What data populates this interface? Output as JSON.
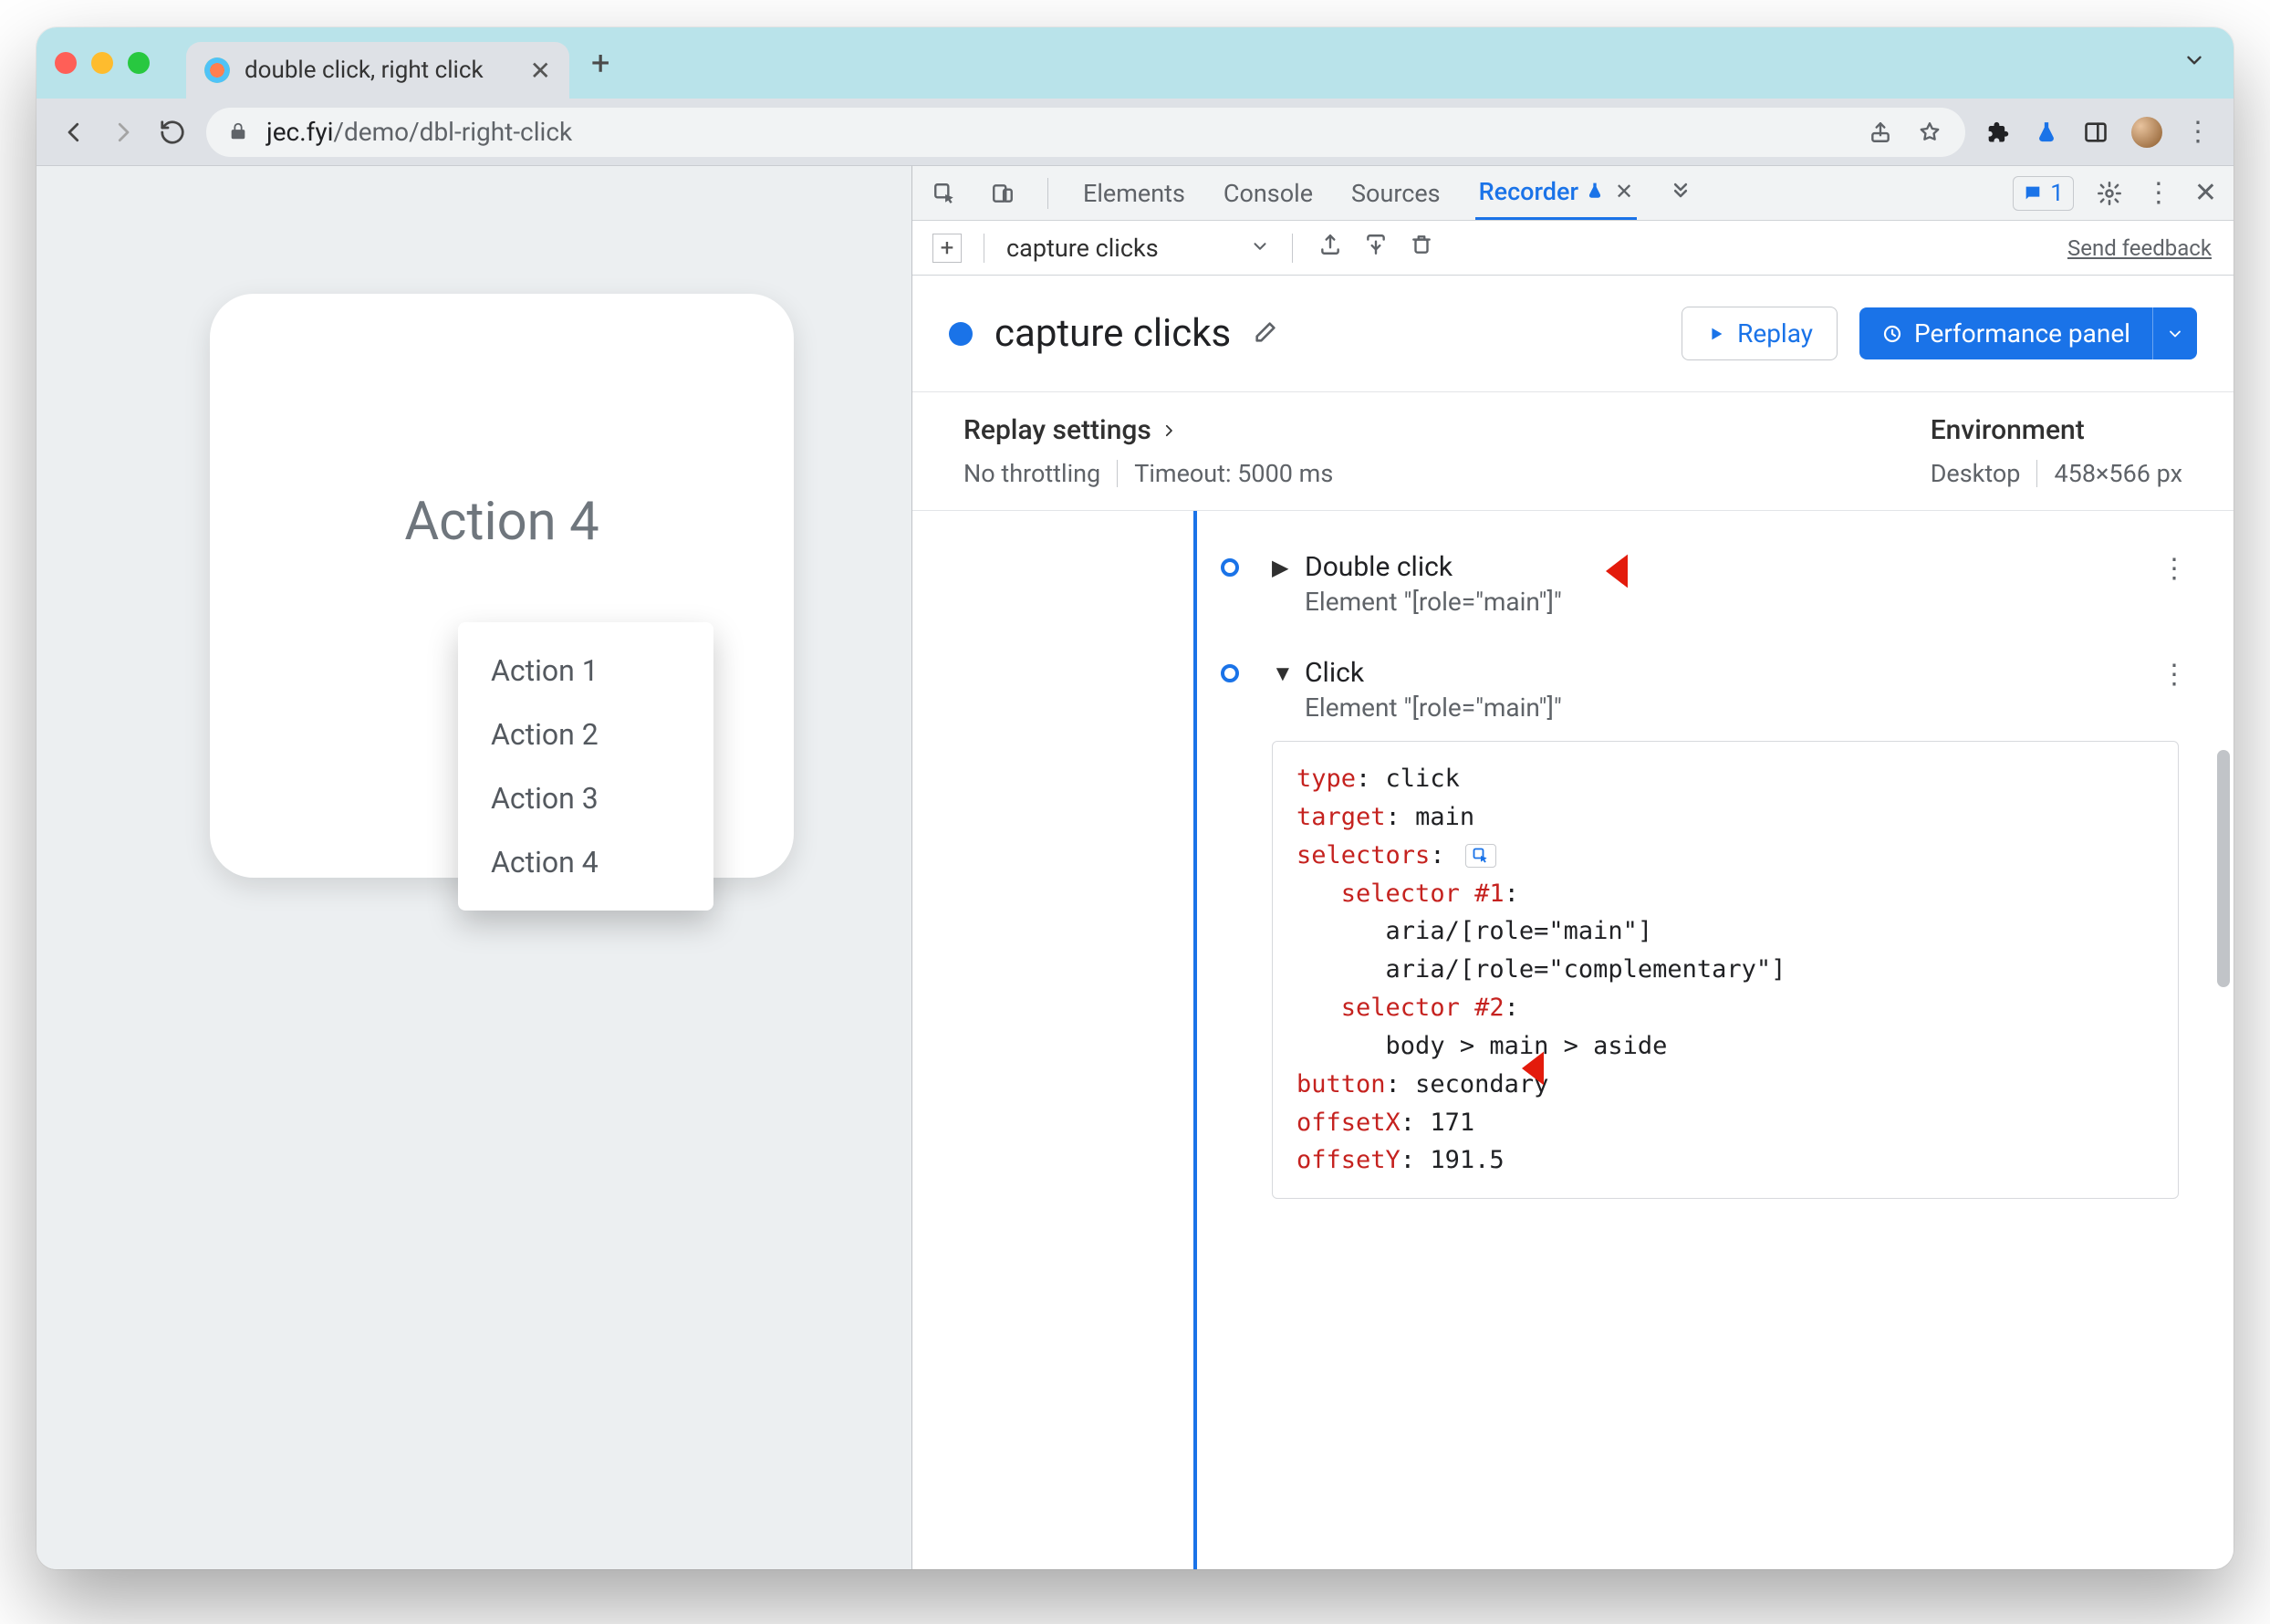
{
  "browser": {
    "tab_title": "double click, right click",
    "url_host": "jec.fyi",
    "url_path": "/demo/dbl-right-click"
  },
  "page": {
    "card_title": "Action 4",
    "context_menu": [
      "Action 1",
      "Action 2",
      "Action 3",
      "Action 4"
    ]
  },
  "devtools": {
    "tabs": {
      "elements": "Elements",
      "console": "Console",
      "sources": "Sources",
      "recorder": "Recorder"
    },
    "issues_count": "1",
    "feedback": "Send feedback",
    "toolbar_name": "capture clicks",
    "title": "capture clicks",
    "replay_btn": "Replay",
    "perf_btn": "Performance panel",
    "settings": {
      "replay_label": "Replay settings",
      "throttling": "No throttling",
      "timeout": "Timeout: 5000 ms",
      "env_label": "Environment",
      "env_device": "Desktop",
      "env_size": "458×566 px"
    },
    "steps": [
      {
        "title": "Double click",
        "subtitle": "Element \"[role=\"main\"]\"",
        "expanded": false
      },
      {
        "title": "Click",
        "subtitle": "Element \"[role=\"main\"]\"",
        "expanded": true,
        "details": {
          "type_k": "type",
          "type_v": "click",
          "target_k": "target",
          "target_v": "main",
          "selectors_k": "selectors",
          "sel1_k": "selector #1",
          "sel1_a": "aria/[role=\"main\"]",
          "sel1_b": "aria/[role=\"complementary\"]",
          "sel2_k": "selector #2",
          "sel2_a": "body > main > aside",
          "button_k": "button",
          "button_v": "secondary",
          "offx_k": "offsetX",
          "offx_v": "171",
          "offy_k": "offsetY",
          "offy_v": "191.5"
        }
      }
    ]
  }
}
